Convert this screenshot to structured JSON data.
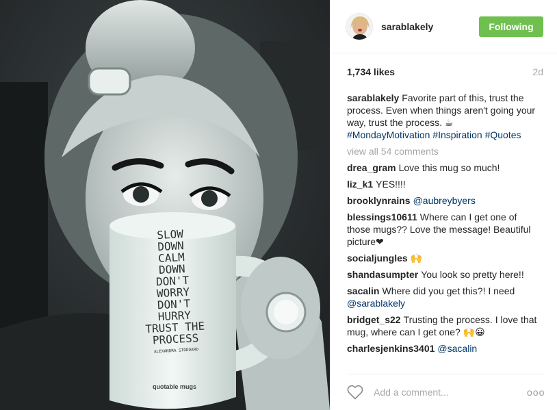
{
  "post": {
    "username": "sarablakely",
    "follow_label": "Following",
    "likes": "1,734 likes",
    "age": "2d",
    "caption": {
      "user": "sarablakely",
      "text": "Favorite part of this, trust the process. Even when things aren't going your way, trust the process. ☕",
      "tags": [
        "#MondayMotivation",
        "#Inspiration",
        "#Quotes"
      ]
    },
    "view_all": "view all 54 comments",
    "comments": [
      {
        "user": "drea_gram",
        "text": "Love this mug so much!",
        "mention": ""
      },
      {
        "user": "liz_k1",
        "text": "YES!!!!",
        "mention": ""
      },
      {
        "user": "brooklynrains",
        "text": "",
        "mention": "@aubreybyers"
      },
      {
        "user": "blessings10611",
        "text": "Where can I get one of those mugs?? Love the message! Beautiful picture❤",
        "mention": ""
      },
      {
        "user": "socialjungles",
        "text": "🙌",
        "mention": ""
      },
      {
        "user": "shandasumpter",
        "text": "You look so pretty here!!",
        "mention": ""
      },
      {
        "user": "sacalin",
        "text": "Where did you get this?! I need",
        "mention": "@sarablakely"
      },
      {
        "user": "bridget_s22",
        "text": "Trusting the process. I love that mug, where can I get one? 🙌😀",
        "mention": ""
      },
      {
        "user": "charlesjenkins3401",
        "text": "",
        "mention": "@sacalin"
      }
    ],
    "comment_placeholder": "Add a comment...",
    "more_label": "ooo"
  },
  "mug": {
    "lines": [
      "SLOW",
      "DOWN",
      "CALM",
      "DOWN",
      "DON'T",
      "WORRY",
      "DON'T",
      "HURRY",
      "TRUST THE",
      "PROCESS"
    ],
    "author": "ALEXANDRA STODDARD",
    "brand": "quotable mugs"
  },
  "icons": {
    "heart": "heart-outline-icon",
    "more": "more-options-icon"
  },
  "colors": {
    "follow_green": "#70c050",
    "link_blue": "#003569",
    "muted_grey": "#a5a7aa"
  }
}
